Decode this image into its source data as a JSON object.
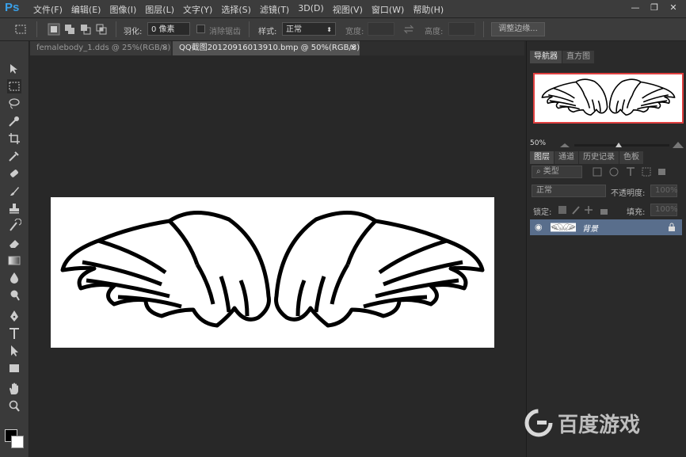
{
  "app": {
    "logo": "Ps"
  },
  "menu": [
    "文件(F)",
    "编辑(E)",
    "图像(I)",
    "图层(L)",
    "文字(Y)",
    "选择(S)",
    "滤镜(T)",
    "3D(D)",
    "视图(V)",
    "窗口(W)",
    "帮助(H)"
  ],
  "window_controls": {
    "minimize": "—",
    "restore": "❐",
    "close": "✕"
  },
  "options": {
    "feather_label": "羽化:",
    "feather_value": "0 像素",
    "antialias_label": "消除锯齿",
    "style_label": "样式:",
    "style_value": "正常",
    "width_label": "宽度:",
    "height_label": "高度:",
    "refine_edge": "调整边缘..."
  },
  "tabs": [
    {
      "label": "femalebody_1.dds @ 25%(RGB/8)",
      "close": "×"
    },
    {
      "label": "QQ截图20120916013910.bmp @ 50%(RGB/8)",
      "close": "×"
    }
  ],
  "navigator": {
    "tabs": [
      "导航器",
      "直方图"
    ],
    "zoom": "50%"
  },
  "layers_panel": {
    "tabs": [
      "图层",
      "通道",
      "历史记录",
      "色板"
    ],
    "filter_kind": "类型",
    "blend_mode": "正常",
    "opacity_label": "不透明度:",
    "opacity_value": "100%",
    "lock_label": "锁定:",
    "fill_label": "填充:",
    "fill_value": "100%",
    "layer_name": "背景"
  },
  "watermark": {
    "text": "百度游戏"
  },
  "colors": {
    "accent": "#3aa0e8",
    "layer_selected": "#596e8c",
    "nav_frame": "#e04040"
  }
}
